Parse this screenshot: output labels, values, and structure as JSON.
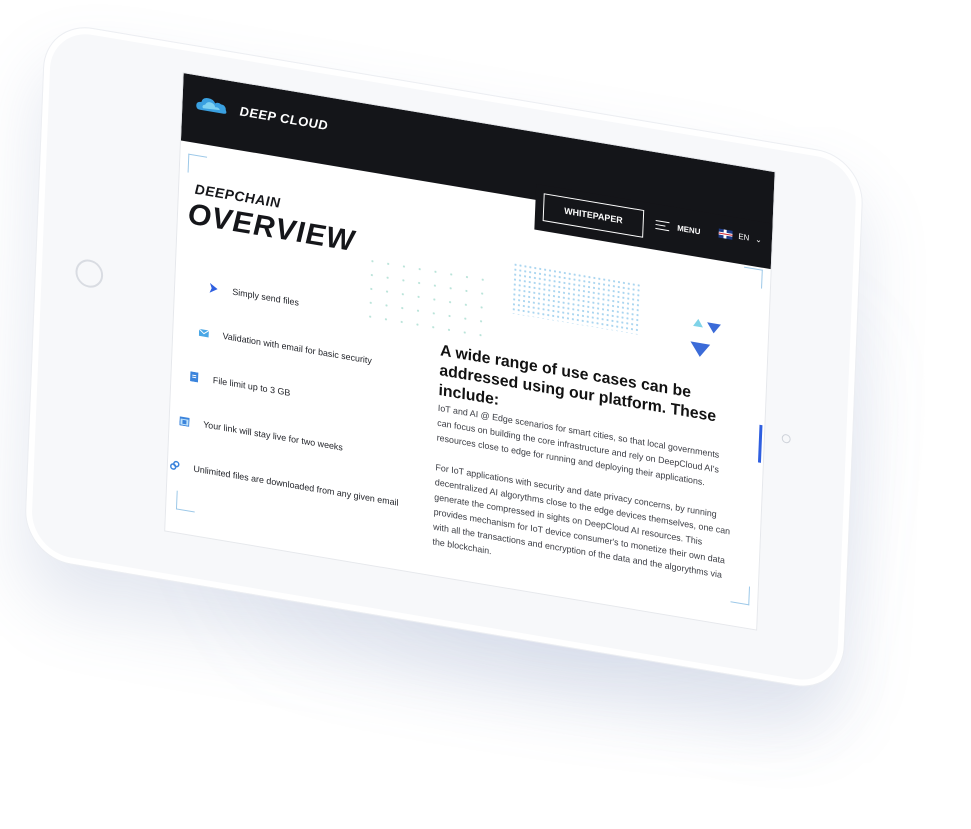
{
  "brand": {
    "name": "DEEP CLOUD",
    "logo_icon": "cloud-logo-icon"
  },
  "header": {
    "whitepaper_label": "WHITEPAPER",
    "menu_label": "MENU",
    "language": "EN"
  },
  "hero": {
    "kicker": "DEEPCHAIN",
    "title": "OVERVIEW"
  },
  "features": [
    {
      "icon": "send-arrow-icon",
      "label": "Simply send files"
    },
    {
      "icon": "shield-mail-icon",
      "label": "Validation with email for basic security"
    },
    {
      "icon": "file-icon",
      "label": "File limit up to 3 GB"
    },
    {
      "icon": "calendar-icon",
      "label": "Your link will stay live for two weeks"
    },
    {
      "icon": "link-icon",
      "label": "Unlimited files are downloaded from any given email"
    }
  ],
  "content": {
    "heading": "A wide range of use cases can be addressed using our platform. These include:",
    "paragraph_1": "IoT and AI @ Edge scenarios for smart cities, so that local governments can focus on building the core infrastructure and rely on DeepCloud AI's resources close to edge for running and deploying their applications.",
    "paragraph_2": "For IoT applications with security and date privacy concerns, by running decentralized AI algorythms close to the edge devices themselves, one can generate the compressed in sights on DeepCloud AI resources. This provides mechanism for IoT device consumer's to monetize their own data with all the transactions and encryption of the data and the algorythms via the blockchain."
  },
  "colors": {
    "topbar": "#141519",
    "accent_blue": "#2f5fe0",
    "accent_light_blue": "#7fc4ec",
    "text_dark": "#15161a"
  }
}
